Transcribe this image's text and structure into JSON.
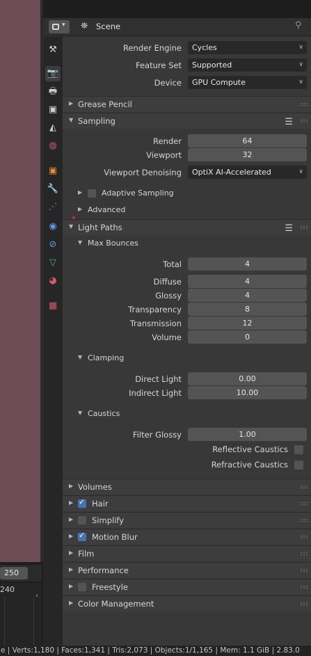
{
  "timeline": {
    "frame_end": "250",
    "frame_number": "240"
  },
  "header": {
    "scene_label": "Scene",
    "editor_type_icon": "properties-editor-icon",
    "scene_icon": "scene-icon",
    "pin_icon": "pin-icon"
  },
  "tabs": [
    {
      "name": "tool",
      "icon": "tool-icon"
    },
    {
      "name": "render",
      "icon": "render-icon",
      "active": true
    },
    {
      "name": "output",
      "icon": "output-icon"
    },
    {
      "name": "view-layer",
      "icon": "view-layer-icon"
    },
    {
      "name": "scene",
      "icon": "scene-icon"
    },
    {
      "name": "world",
      "icon": "world-icon"
    },
    {
      "name": "object",
      "icon": "object-icon"
    },
    {
      "name": "modifiers",
      "icon": "wrench-icon"
    },
    {
      "name": "particles",
      "icon": "particles-icon"
    },
    {
      "name": "physics",
      "icon": "physics-icon"
    },
    {
      "name": "constraints",
      "icon": "constraints-icon"
    },
    {
      "name": "data",
      "icon": "mesh-data-icon"
    },
    {
      "name": "material",
      "icon": "material-icon"
    },
    {
      "name": "texture",
      "icon": "texture-icon"
    }
  ],
  "render": {
    "render_engine_label": "Render Engine",
    "render_engine_value": "Cycles",
    "feature_set_label": "Feature Set",
    "feature_set_value": "Supported",
    "device_label": "Device",
    "device_value": "GPU Compute"
  },
  "panels": {
    "grease_pencil": "Grease Pencil",
    "sampling": "Sampling",
    "light_paths": "Light Paths",
    "volumes": "Volumes",
    "hair": "Hair",
    "simplify": "Simplify",
    "motion_blur": "Motion Blur",
    "film": "Film",
    "performance": "Performance",
    "freestyle": "Freestyle",
    "color_management": "Color Management"
  },
  "sampling": {
    "render_label": "Render",
    "render_value": "64",
    "viewport_label": "Viewport",
    "viewport_value": "32",
    "denoising_label": "Viewport Denoising",
    "denoising_value": "OptiX AI-Accelerated",
    "adaptive_label": "Adaptive Sampling",
    "advanced_label": "Advanced"
  },
  "light_paths": {
    "max_bounces": "Max Bounces",
    "total_label": "Total",
    "total_value": "4",
    "diffuse_label": "Diffuse",
    "diffuse_value": "4",
    "glossy_label": "Glossy",
    "glossy_value": "4",
    "transparency_label": "Transparency",
    "transparency_value": "8",
    "transmission_label": "Transmission",
    "transmission_value": "12",
    "volume_label": "Volume",
    "volume_value": "0",
    "clamping": "Clamping",
    "direct_label": "Direct Light",
    "direct_value": "0.00",
    "indirect_label": "Indirect Light",
    "indirect_value": "10.00",
    "caustics": "Caustics",
    "filter_glossy_label": "Filter Glossy",
    "filter_glossy_value": "1.00",
    "reflective_label": "Reflective Caustics",
    "refractive_label": "Refractive Caustics"
  },
  "statusbar": {
    "text": "e | Verts:1,180 | Faces:1,341 | Tris:2,073 | Objects:1/1,165 | Mem: 1.1 GiB | 2.83.0"
  },
  "colors": {
    "accent": "#4772b3",
    "viewport_bg": "#6e4c55",
    "panel_bg": "#383838"
  }
}
